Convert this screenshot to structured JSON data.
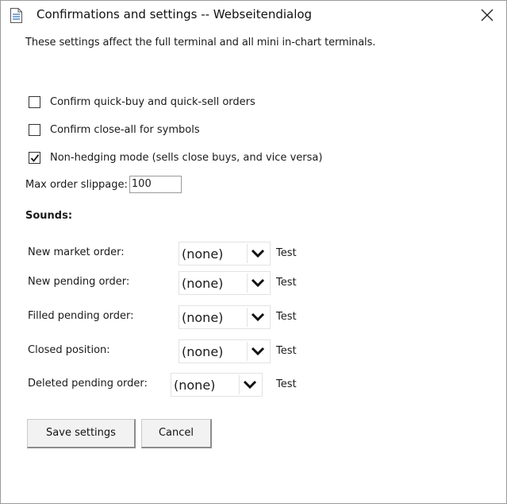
{
  "window": {
    "title": "Confirmations and settings -- Webseitendialog"
  },
  "intro_text": "These settings affect the full terminal and all mini in-chart terminals.",
  "checkboxes": [
    {
      "label": "Confirm quick-buy and quick-sell orders",
      "checked": false
    },
    {
      "label": "Confirm close-all for symbols",
      "checked": false
    },
    {
      "label": "Non-hedging mode (sells close buys, and vice versa)",
      "checked": true
    }
  ],
  "slippage": {
    "label": "Max order slippage:",
    "value": "100"
  },
  "sounds": {
    "heading": "Sounds:",
    "test_label": "Test",
    "rows": [
      {
        "label": "New market order:",
        "value": "(none)"
      },
      {
        "label": "New pending order:",
        "value": "(none)"
      },
      {
        "label": "Filled pending order:",
        "value": "(none)"
      },
      {
        "label": "Closed position:",
        "value": "(none)"
      },
      {
        "label": "Deleted pending order:",
        "value": "(none)"
      }
    ]
  },
  "buttons": {
    "save": "Save settings",
    "cancel": "Cancel"
  },
  "icons": {
    "title": "document-icon",
    "close": "close-icon",
    "check": "checkmark-icon",
    "dropdown": "chevron-down-icon"
  }
}
